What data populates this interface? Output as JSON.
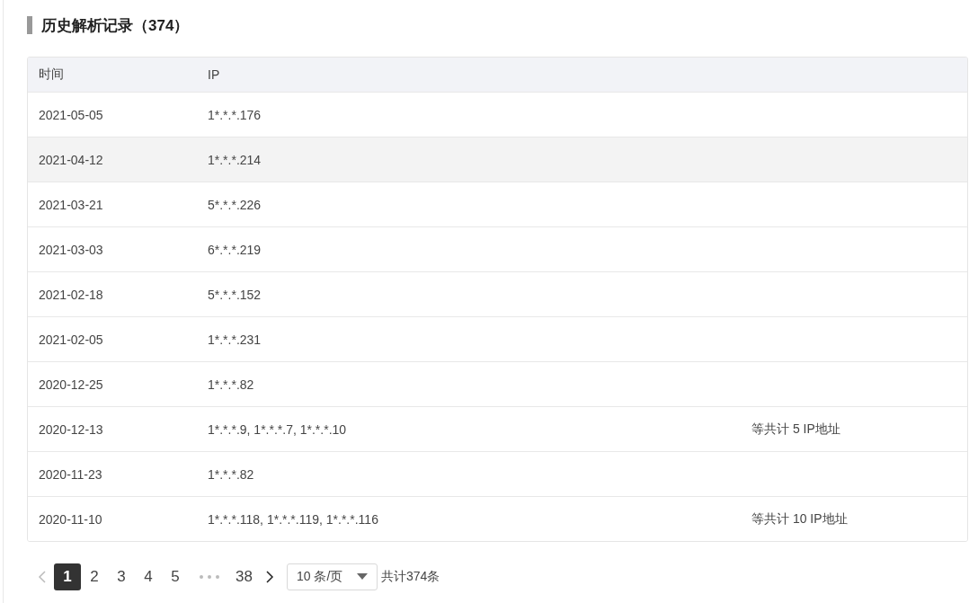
{
  "section": {
    "title": "历史解析记录（374）"
  },
  "table": {
    "columns": [
      "时间",
      "IP"
    ],
    "rows": [
      {
        "date": "2021-05-05",
        "ip": "1*.*.*.176",
        "highlighted": false
      },
      {
        "date": "2021-04-12",
        "ip": "1*.*.*.214",
        "highlighted": true
      },
      {
        "date": "2021-03-21",
        "ip": "5*.*.*.226",
        "highlighted": false
      },
      {
        "date": "2021-03-03",
        "ip": "6*.*.*.219",
        "highlighted": false
      },
      {
        "date": "2021-02-18",
        "ip": "5*.*.*.152",
        "highlighted": false
      },
      {
        "date": "2021-02-05",
        "ip": "1*.*.*.231",
        "highlighted": false
      },
      {
        "date": "2020-12-25",
        "ip": "1*.*.*.82",
        "highlighted": false
      },
      {
        "date": "2020-12-13",
        "ip": "1*.*.*.9, 1*.*.*.7, 1*.*.*.10",
        "total": "等共计 5 IP地址",
        "highlighted": false
      },
      {
        "date": "2020-11-23",
        "ip": "1*.*.*.82",
        "highlighted": false
      },
      {
        "date": "2020-11-10",
        "ip": "1*.*.*.118, 1*.*.*.119, 1*.*.*.116",
        "total": "等共计 10 IP地址",
        "highlighted": false
      }
    ]
  },
  "pagination": {
    "prev_disabled": true,
    "pages": [
      {
        "kind": "page",
        "label": "1",
        "selected": true
      },
      {
        "kind": "page",
        "label": "2",
        "selected": false
      },
      {
        "kind": "page",
        "label": "3",
        "selected": false
      },
      {
        "kind": "page",
        "label": "4",
        "selected": false
      },
      {
        "kind": "page",
        "label": "5",
        "selected": false
      },
      {
        "kind": "ellipsis"
      },
      {
        "kind": "page",
        "label": "38",
        "selected": false
      }
    ],
    "page_size": "10 条/页",
    "total": "共计374条"
  }
}
